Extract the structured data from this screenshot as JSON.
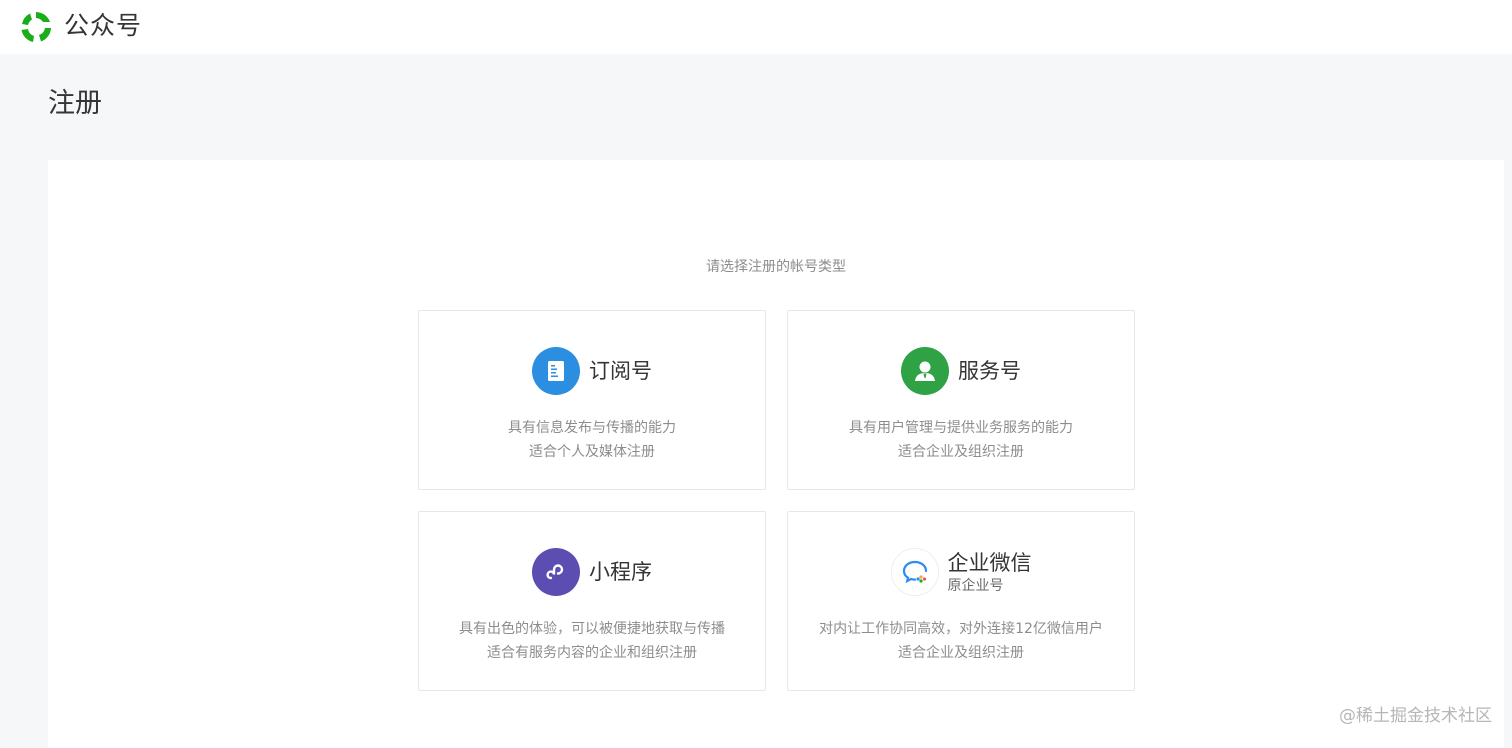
{
  "header": {
    "brand": "公众号",
    "logo_icon": "wechat-official-accounts-logo",
    "logo_color": "#1aad19"
  },
  "page": {
    "title": "注册",
    "prompt": "请选择注册的帐号类型"
  },
  "cards": [
    {
      "title": "订阅号",
      "icon": "document-icon",
      "icon_color": "#2c8ee0",
      "desc_line1": "具有信息发布与传播的能力",
      "desc_line2": "适合个人及媒体注册"
    },
    {
      "title": "服务号",
      "icon": "person-icon",
      "icon_color": "#2fa246",
      "desc_line1": "具有用户管理与提供业务服务的能力",
      "desc_line2": "适合企业及组织注册"
    },
    {
      "title": "小程序",
      "icon": "mini-program-icon",
      "icon_color": "#5b4db1",
      "desc_line1": "具有出色的体验，可以被便捷地获取与传播",
      "desc_line2": "适合有服务内容的企业和组织注册"
    },
    {
      "title": "企业微信",
      "subtitle": "原企业号",
      "icon": "wecom-icon",
      "icon_color": "#2d8cf0",
      "desc_line1": "对内让工作协同高效，对外连接12亿微信用户",
      "desc_line2": "适合企业及组织注册"
    }
  ],
  "watermark": "@稀土掘金技术社区"
}
